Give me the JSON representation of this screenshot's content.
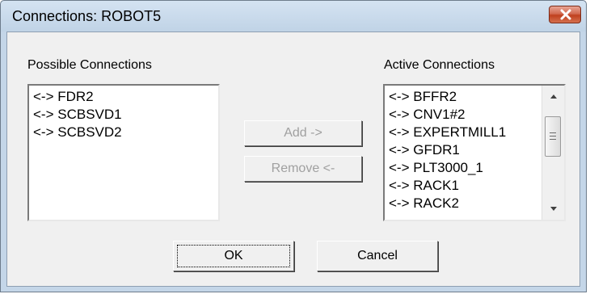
{
  "window": {
    "title": "Connections: ROBOT5"
  },
  "possible": {
    "label": "Possible Connections",
    "items": [
      "<-> FDR2",
      "<-> SCBSVD1",
      "<-> SCBSVD2"
    ]
  },
  "active": {
    "label": "Active Connections",
    "items": [
      "<-> BFFR2",
      "<-> CNV1#2",
      "<-> EXPERTMILL1",
      "<-> GFDR1",
      "<-> PLT3000_1",
      "<-> RACK1",
      "<-> RACK2"
    ]
  },
  "buttons": {
    "add": "Add ->",
    "remove": "Remove <-",
    "ok": "OK",
    "cancel": "Cancel"
  },
  "icons": {
    "close": "close-icon",
    "scroll_up": "scroll-up-icon",
    "scroll_down": "scroll-down-icon"
  },
  "colors": {
    "close_button": "#c8462a",
    "window_frame": "#c4d6e8",
    "disabled_text": "#a0a0a0"
  }
}
